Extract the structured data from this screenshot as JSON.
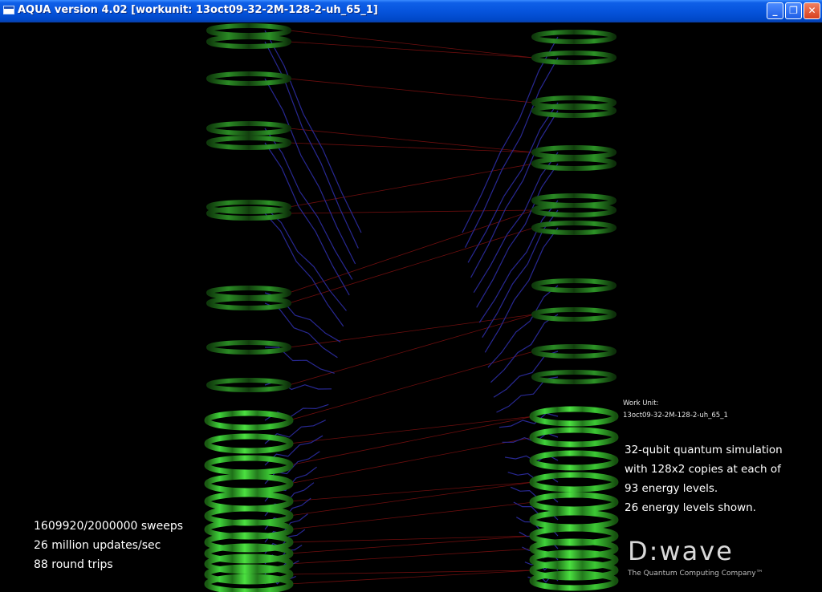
{
  "window": {
    "title": "AQUA version 4.02 [workunit: 13oct09-32-2M-128-2-uh_65_1]",
    "minimize_label": "_",
    "restore_label": "❐",
    "close_label": "✕"
  },
  "work_unit": {
    "label": "Work Unit:",
    "id": "13oct09-32-2M-128-2-uh_65_1"
  },
  "simulation_info": {
    "line1": "32-qubit quantum simulation",
    "line2": "with 128x2 copies at each of",
    "line3": "93 energy levels.",
    "line4": "26 energy levels shown."
  },
  "stats": {
    "sweeps": "1609920/2000000 sweeps",
    "updates": "26 million updates/sec",
    "round_trips": "88 round trips"
  },
  "logo": {
    "brand": "D:wave",
    "tagline": "The Quantum Computing Company™"
  },
  "colors": {
    "titlebar": "#0654dc",
    "background": "#000000",
    "ring_green": "#3fd23a",
    "connector_blue": "#2a2a9a",
    "link_red": "#7a1010"
  },
  "energy_levels_shown": 26
}
